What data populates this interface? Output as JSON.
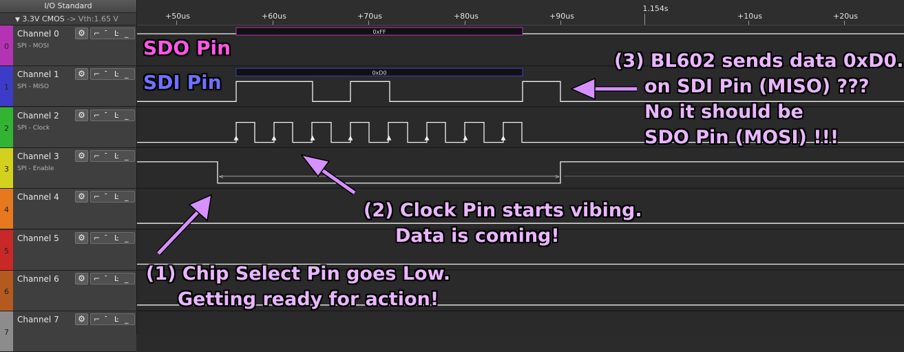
{
  "io": {
    "title": "I/O Standard",
    "voltage": "3.3V CMOS",
    "vth": "-> Vth:1.65 V"
  },
  "ruler": {
    "top_marker": "1.154s",
    "ticks": [
      "+50us",
      "+60us",
      "+70us",
      "+80us",
      "+90us",
      "+10us",
      "+20us"
    ]
  },
  "channels": [
    {
      "name": "Channel 0",
      "sub": "SPI - MOSI",
      "idx": "0",
      "color": "#b432b4"
    },
    {
      "name": "Channel 1",
      "sub": "SPI - MISO",
      "idx": "1",
      "color": "#3c3cc8"
    },
    {
      "name": "Channel 2",
      "sub": "SPI - Clock",
      "idx": "2",
      "color": "#32b432"
    },
    {
      "name": "Channel 3",
      "sub": "SPI - Enable",
      "idx": "3",
      "color": "#d2d21e"
    },
    {
      "name": "Channel 4",
      "sub": "",
      "idx": "4",
      "color": "#e6781e"
    },
    {
      "name": "Channel 5",
      "sub": "",
      "idx": "5",
      "color": "#c82828"
    },
    {
      "name": "Channel 6",
      "sub": "",
      "idx": "6",
      "color": "#b45a1e"
    },
    {
      "name": "Channel 7",
      "sub": "",
      "idx": "7",
      "color": "#8c8c8c"
    }
  ],
  "trigger_icons": [
    "⌐",
    "¯",
    "Ŀ",
    "_"
  ],
  "decoded": {
    "mosi_value": "0xFF",
    "miso_value": "0xD0",
    "mosi_color": "#b432b4",
    "miso_color": "#3c3cc8"
  },
  "labels": {
    "sdo": "SDO Pin",
    "sdi": "SDI Pin"
  },
  "annotations": {
    "note1": [
      "(1) Chip Select Pin goes Low.",
      "Getting ready for action!"
    ],
    "note2": [
      "(2) Clock Pin starts vibing.",
      "Data is coming!"
    ],
    "note3": [
      "(3) BL602 sends data 0xD0...",
      "on SDI Pin (MISO) ???",
      "No it should be",
      "SDO Pin (MOSI) !!!"
    ],
    "color": "#e9b6ff"
  }
}
